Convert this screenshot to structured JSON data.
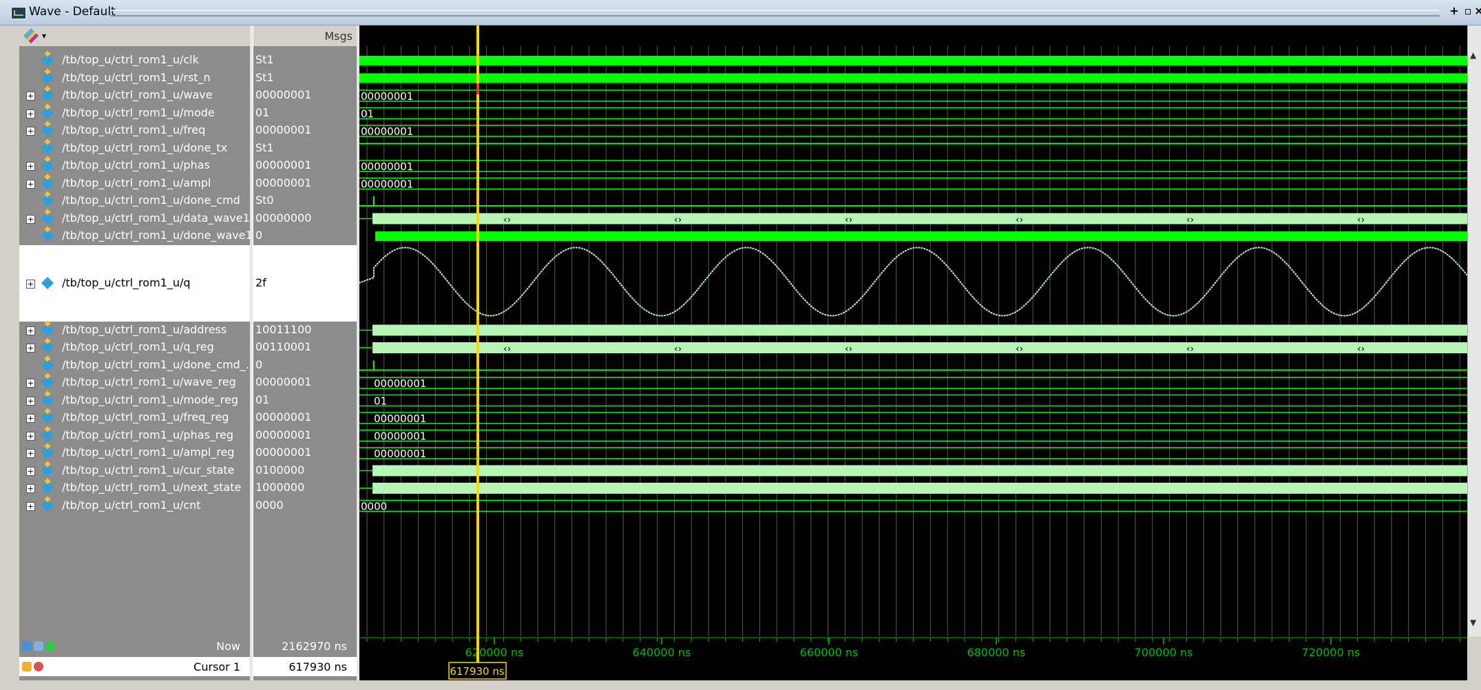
{
  "window": {
    "title": "Wave - Default"
  },
  "header": {
    "msgs_label": "Msgs"
  },
  "signals": [
    {
      "name": "/tb/top_u/ctrl_rom1_u/clk",
      "value": "St1",
      "expandable": false
    },
    {
      "name": "/tb/top_u/ctrl_rom1_u/rst_n",
      "value": "St1",
      "expandable": false
    },
    {
      "name": "/tb/top_u/ctrl_rom1_u/wave",
      "value": "00000001",
      "expandable": true
    },
    {
      "name": "/tb/top_u/ctrl_rom1_u/mode",
      "value": "01",
      "expandable": true
    },
    {
      "name": "/tb/top_u/ctrl_rom1_u/freq",
      "value": "00000001",
      "expandable": true
    },
    {
      "name": "/tb/top_u/ctrl_rom1_u/done_tx",
      "value": "St1",
      "expandable": false
    },
    {
      "name": "/tb/top_u/ctrl_rom1_u/phas",
      "value": "00000001",
      "expandable": true
    },
    {
      "name": "/tb/top_u/ctrl_rom1_u/ampl",
      "value": "00000001",
      "expandable": true
    },
    {
      "name": "/tb/top_u/ctrl_rom1_u/done_cmd",
      "value": "St0",
      "expandable": false
    },
    {
      "name": "/tb/top_u/ctrl_rom1_u/data_wave1",
      "value": "00000000",
      "expandable": true
    },
    {
      "name": "/tb/top_u/ctrl_rom1_u/done_wave1",
      "value": "0",
      "expandable": false
    },
    {
      "name": "/tb/top_u/ctrl_rom1_u/q",
      "value": "2f",
      "expandable": true,
      "analog": true
    },
    {
      "name": "/tb/top_u/ctrl_rom1_u/address",
      "value": "10011100",
      "expandable": true
    },
    {
      "name": "/tb/top_u/ctrl_rom1_u/q_reg",
      "value": "00110001",
      "expandable": true
    },
    {
      "name": "/tb/top_u/ctrl_rom1_u/done_cmd_...",
      "value": "0",
      "expandable": false
    },
    {
      "name": "/tb/top_u/ctrl_rom1_u/wave_reg",
      "value": "00000001",
      "expandable": true
    },
    {
      "name": "/tb/top_u/ctrl_rom1_u/mode_reg",
      "value": "01",
      "expandable": true
    },
    {
      "name": "/tb/top_u/ctrl_rom1_u/freq_reg",
      "value": "00000001",
      "expandable": true
    },
    {
      "name": "/tb/top_u/ctrl_rom1_u/phas_reg",
      "value": "00000001",
      "expandable": true
    },
    {
      "name": "/tb/top_u/ctrl_rom1_u/ampl_reg",
      "value": "00000001",
      "expandable": true
    },
    {
      "name": "/tb/top_u/ctrl_rom1_u/cur_state",
      "value": "0100000",
      "expandable": true
    },
    {
      "name": "/tb/top_u/ctrl_rom1_u/next_state",
      "value": "1000000",
      "expandable": true
    },
    {
      "name": "/tb/top_u/ctrl_rom1_u/cnt",
      "value": "0000",
      "expandable": true
    }
  ],
  "wave_labels": {
    "wave": "00000001",
    "mode": "01",
    "freq": "00000001",
    "phas": "00000001",
    "ampl": "00000001",
    "wave_reg": "00000001",
    "mode_reg": "01",
    "freq_reg": "00000001",
    "phas_reg": "00000001",
    "ampl_reg": "00000001",
    "cnt": "0000"
  },
  "footer": {
    "now_label": "Now",
    "now_value": "2162970 ns",
    "cursor_label": "Cursor 1",
    "cursor_value": "617930 ns"
  },
  "timeline": {
    "ticks": [
      "620000 ns",
      "640000 ns",
      "660000 ns",
      "680000 ns",
      "700000 ns",
      "720000 ns"
    ],
    "cursor_time": "617930 ns"
  },
  "colors": {
    "signal": "#00ff00",
    "bus": "#b6f5b6",
    "cursor": "#ffd700",
    "analog": "#b6f5b6"
  }
}
